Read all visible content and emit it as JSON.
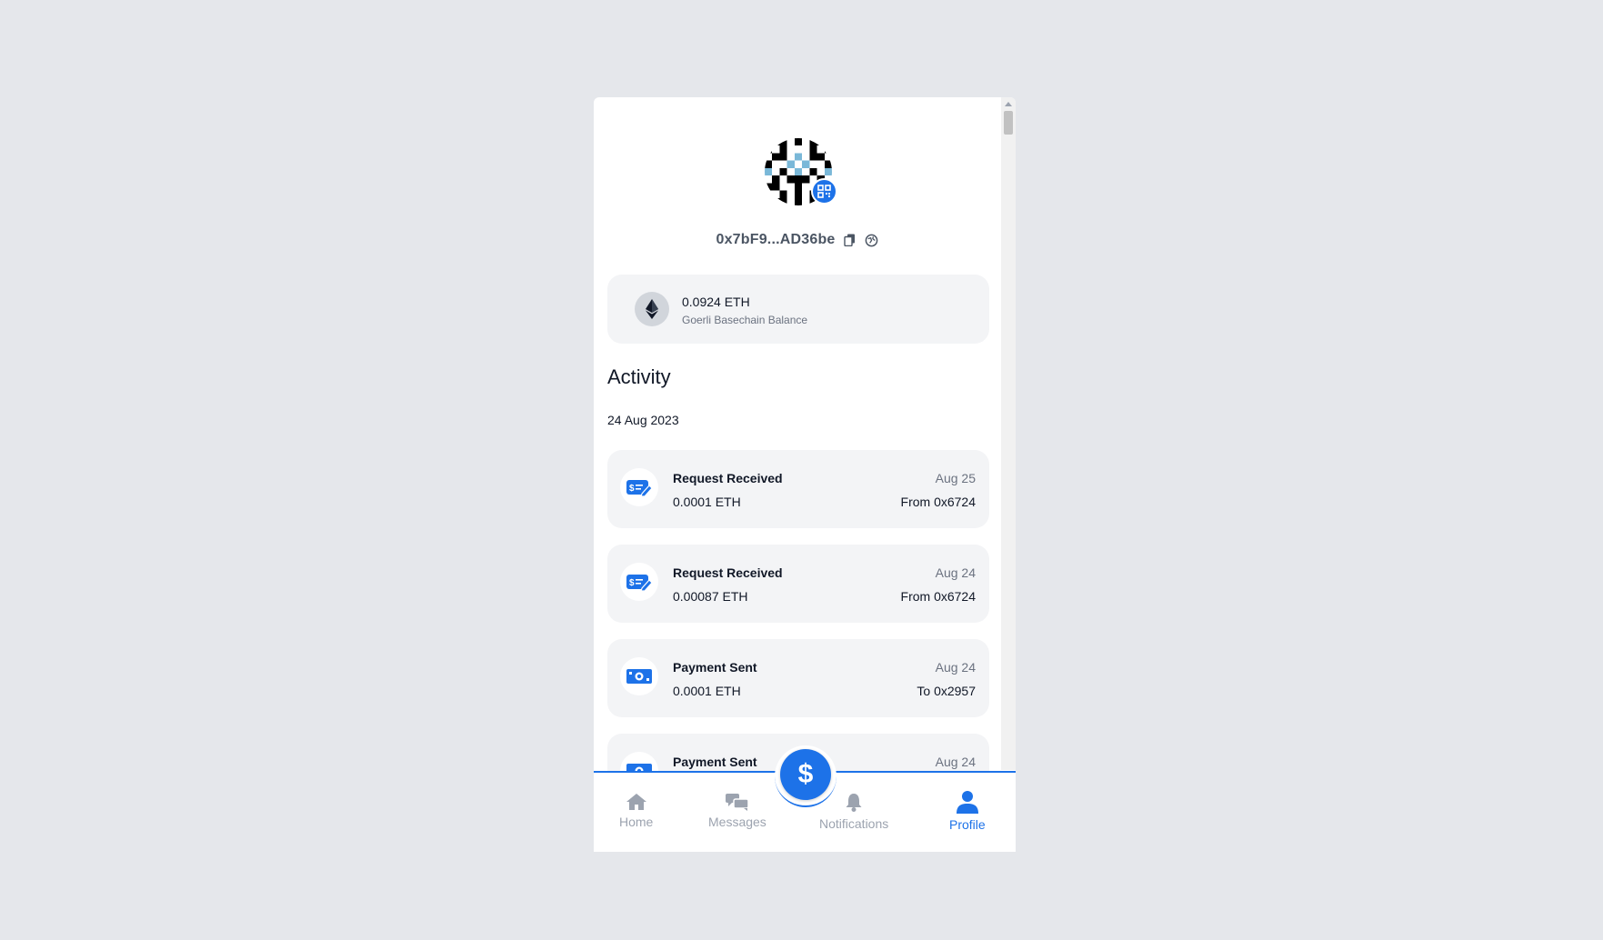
{
  "profile": {
    "address": "0x7bF9...AD36be",
    "avatar_icon": "identicon-avatar",
    "qr_icon": "qr-code-icon",
    "copy_icon": "copy-icon",
    "explorer_icon": "globe-explorer-icon"
  },
  "balance": {
    "value": "0.0924 ETH",
    "label": "Goerli Basechain Balance",
    "icon": "ethereum-icon"
  },
  "activity": {
    "title": "Activity",
    "date_group": "24 Aug 2023",
    "items": [
      {
        "title": "Request Received",
        "amount": "0.0001 ETH",
        "date": "Aug 25",
        "party": "From 0x6724",
        "icon": "request-icon"
      },
      {
        "title": "Request Received",
        "amount": "0.00087 ETH",
        "date": "Aug 24",
        "party": "From 0x6724",
        "icon": "request-icon"
      },
      {
        "title": "Payment Sent",
        "amount": "0.0001 ETH",
        "date": "Aug 24",
        "party": "To 0x2957",
        "icon": "cash-icon"
      },
      {
        "title": "Payment Sent",
        "amount": "",
        "date": "Aug 24",
        "party": "",
        "icon": "cash-icon"
      }
    ]
  },
  "nav": {
    "fab_symbol": "$",
    "items": [
      {
        "label": "Home",
        "icon": "home-icon"
      },
      {
        "label": "Messages",
        "icon": "messages-icon"
      },
      {
        "label": "Notifications",
        "icon": "bell-icon"
      },
      {
        "label": "Profile",
        "icon": "user-icon"
      }
    ],
    "active": "Profile"
  },
  "colors": {
    "accent": "#1d72e8",
    "card": "#f3f4f6",
    "muted_text": "#6b7280",
    "background": "#e5e7eb"
  }
}
